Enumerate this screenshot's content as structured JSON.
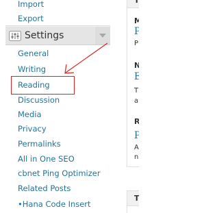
{
  "sidebar": {
    "items_above": [
      {
        "label": "Import"
      },
      {
        "label": "Export"
      }
    ],
    "header": {
      "title": "Settings",
      "icon": "settings-sliders-icon",
      "toggle_icon": "triangle-down-icon"
    },
    "submenu": [
      {
        "label": "General"
      },
      {
        "label": "Writing"
      },
      {
        "label": "Reading"
      },
      {
        "label": "Discussion"
      },
      {
        "label": "Media"
      },
      {
        "label": "Privacy"
      },
      {
        "label": "Permalinks"
      },
      {
        "label": "All in One SEO"
      },
      {
        "label": "cbnet Ping Optimizer"
      },
      {
        "label": "Related Posts"
      },
      {
        "label": "•Hana Code Insert"
      }
    ],
    "link_color": "#21759b"
  },
  "annotation": {
    "color": "#dd2222",
    "target": "Reading"
  },
  "right_panel": {
    "fragments": [
      {
        "text": "T",
        "style": "bold"
      },
      {
        "text": "M",
        "style": "bold"
      },
      {
        "text": "P",
        "style": "link"
      },
      {
        "text": "P",
        "style": "small"
      },
      {
        "text": "N",
        "style": "bold"
      },
      {
        "text": "E",
        "style": "link"
      },
      {
        "text": "T",
        "style": "small"
      },
      {
        "text": "a",
        "style": "small"
      },
      {
        "text": "R",
        "style": "bold"
      },
      {
        "text": "P",
        "style": "link"
      },
      {
        "text": "A",
        "style": "small"
      },
      {
        "text": "n",
        "style": "small"
      },
      {
        "text": "T",
        "style": "bold"
      }
    ]
  }
}
